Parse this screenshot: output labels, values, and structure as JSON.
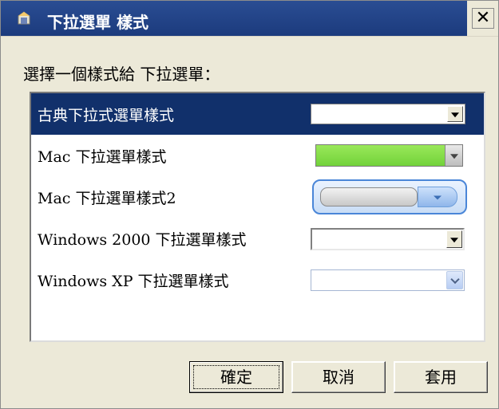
{
  "window": {
    "title": "下拉選單 樣式",
    "close_label": "✕"
  },
  "prompt": "選擇一個樣式給 下拉選單：",
  "styles": [
    {
      "label": "古典下拉式選單樣式",
      "selected": true
    },
    {
      "label": "Mac 下拉選單樣式",
      "selected": false
    },
    {
      "label": "Mac 下拉選單樣式2",
      "selected": false
    },
    {
      "label": "Windows 2000 下拉選單樣式",
      "selected": false
    },
    {
      "label": "Windows XP 下拉選單樣式",
      "selected": false
    }
  ],
  "buttons": {
    "ok": "確定",
    "cancel": "取消",
    "apply": "套用"
  },
  "colors": {
    "titlebar": "#1c3b7d",
    "selection": "#11306b",
    "mac_green": "#7fdc44",
    "dialog_bg": "#ece9d8"
  },
  "icons": {
    "title_icon": "app-icon",
    "close_icon": "close-icon",
    "dropdown_arrow": "chevron-down-icon"
  }
}
